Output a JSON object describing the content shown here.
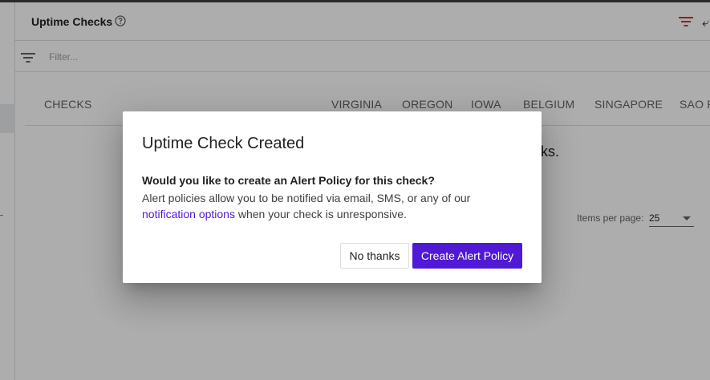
{
  "header": {
    "title": "Uptime Checks",
    "icons": [
      "help-icon",
      "filter-icon"
    ],
    "accent_color": "#d93025"
  },
  "filter": {
    "placeholder": "Filter...",
    "value": ""
  },
  "table": {
    "columns": [
      "CHECKS",
      "VIRGINIA",
      "OREGON",
      "IOWA",
      "BELGIUM",
      "SINGAPORE",
      "SAO P"
    ],
    "empty_text_fragment": "ks."
  },
  "pagination": {
    "label": "Items per page:",
    "value": "25"
  },
  "dialog": {
    "title": "Uptime Check Created",
    "question": "Would you like to create an Alert Policy for this check?",
    "body_before": "Alert policies allow you to be notified via email, SMS, or any of our",
    "link_text": "notification options",
    "body_after": " when your check is unresponsive.",
    "cancel_label": "No thanks",
    "confirm_label": "Create Alert Policy",
    "primary_color": "#5019d6"
  }
}
